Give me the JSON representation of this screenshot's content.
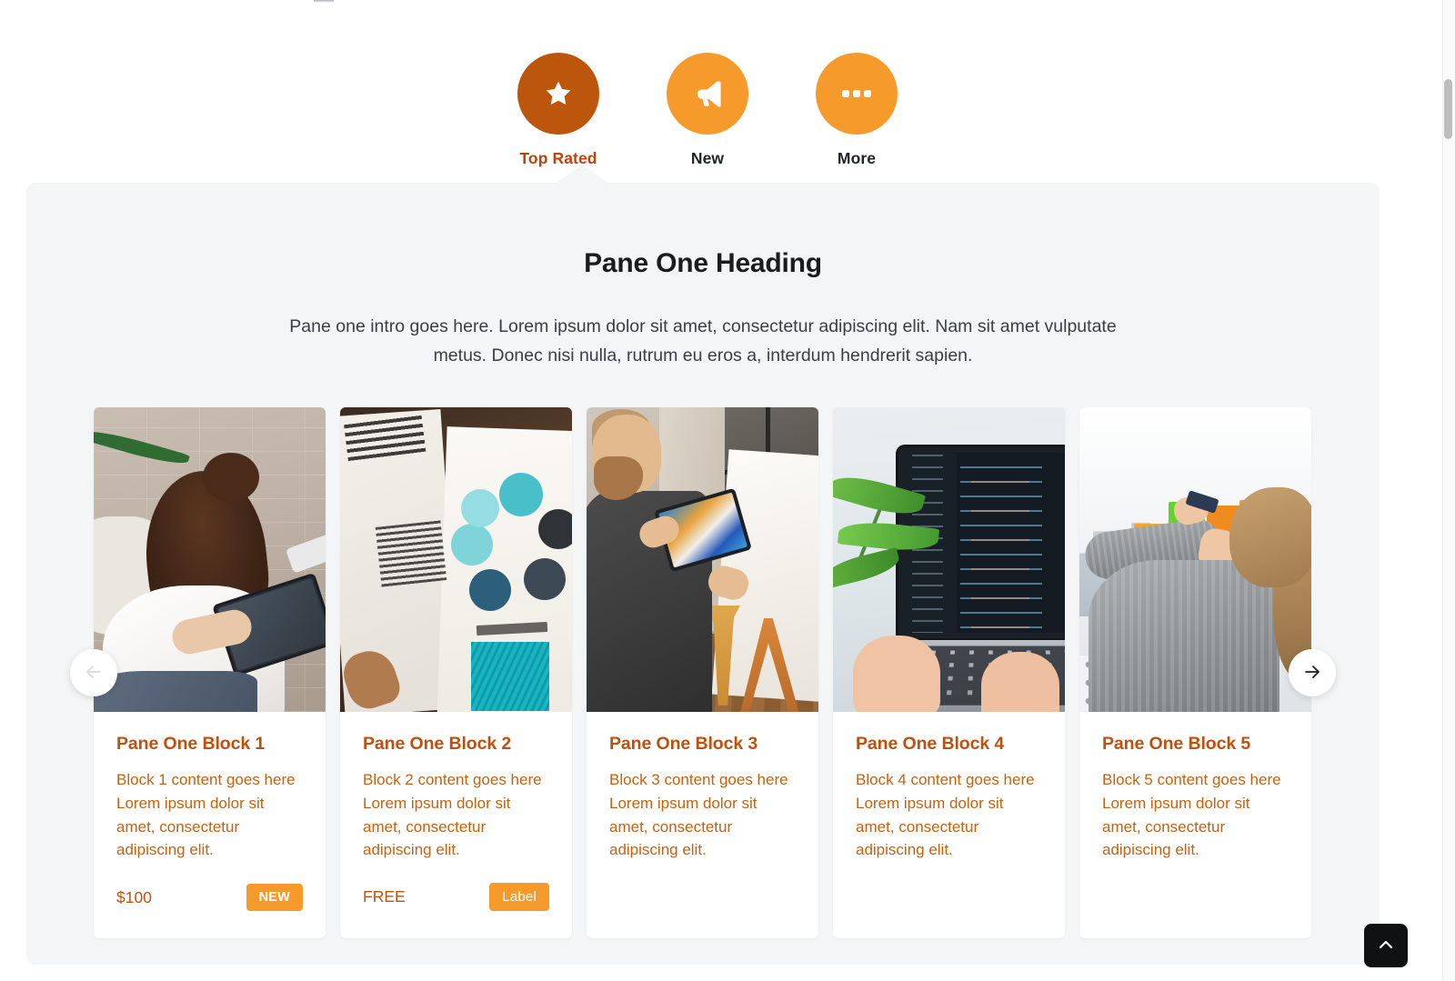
{
  "tabs": [
    {
      "label": "Top Rated",
      "icon": "star-icon",
      "active": true
    },
    {
      "label": "New",
      "icon": "megaphone-icon",
      "active": false
    },
    {
      "label": "More",
      "icon": "ellipsis-icon",
      "active": false
    }
  ],
  "pane": {
    "heading": "Pane One Heading",
    "intro": "Pane one intro goes here. Lorem ipsum dolor sit amet, consectetur adipiscing elit. Nam sit amet vulputate metus. Donec nisi nulla, rutrum eu eros a, interdum hendrerit sapien."
  },
  "cards": [
    {
      "title": "Pane One Block 1",
      "text": "Block 1 content goes here Lorem ipsum dolor sit amet, consectetur adipiscing elit.",
      "price": "$100",
      "badge": "NEW",
      "image_alt": "woman-with-tablet-on-couch"
    },
    {
      "title": "Pane One Block 2",
      "text": "Block 2 content goes here Lorem ipsum dolor sit amet, consectetur adipiscing elit.",
      "price": "FREE",
      "badge": "Label",
      "image_alt": "open-magazine-build-measure-learn-loop"
    },
    {
      "title": "Pane One Block 3",
      "text": "Block 3 content goes here Lorem ipsum dolor sit amet, consectetur adipiscing elit.",
      "price": "",
      "badge": "",
      "image_alt": "man-holding-tablet-at-easel"
    },
    {
      "title": "Pane One Block 4",
      "text": "Block 4 content goes here Lorem ipsum dolor sit amet, consectetur adipiscing elit.",
      "price": "",
      "badge": "",
      "image_alt": "hands-typing-on-laptop-with-code"
    },
    {
      "title": "Pane One Block 5",
      "text": "Block 5 content goes here Lorem ipsum dolor sit amet, consectetur adipiscing elit.",
      "price": "",
      "badge": "",
      "image_alt": "woman-writing-on-sticky-notes-at-window"
    }
  ],
  "carousel": {
    "prev_label": "Previous",
    "next_label": "Next"
  },
  "scroll_top": {
    "label": "Back to top"
  },
  "colors": {
    "accent_active": "#bc560d",
    "accent": "#f59a2b",
    "card_title": "#c2500d",
    "card_text": "#c6620f",
    "panel_bg": "#f3f5f6",
    "page_bg": "#ffffff",
    "scroll_top_bg": "#0f1113"
  }
}
